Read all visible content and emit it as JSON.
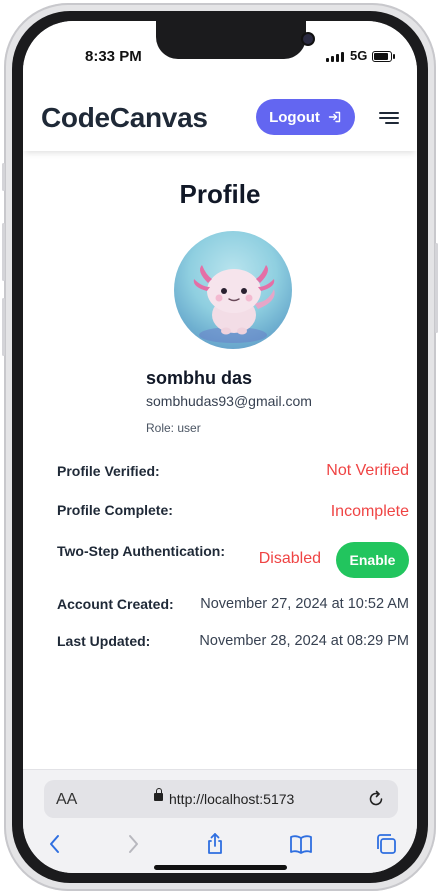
{
  "status_bar": {
    "time": "8:33 PM",
    "network": "5G"
  },
  "header": {
    "brand": "CodeCanvas",
    "logout_label": "Logout"
  },
  "profile": {
    "title": "Profile",
    "name": "sombhu das",
    "email": "sombhudas93@gmail.com",
    "role": "Role: user"
  },
  "details": [
    {
      "label": "Profile Verified:",
      "value": "Not Verified"
    },
    {
      "label": "Profile Complete:",
      "value": "Incomplete"
    },
    {
      "label": "Two-Step Authentication:",
      "value": "Disabled",
      "action": "Enable"
    },
    {
      "label": "Account Created:",
      "value": "November 27, 2024 at 10:52 AM"
    },
    {
      "label": "Last Updated:",
      "value": "November 28, 2024 at 08:29 PM"
    }
  ],
  "browser": {
    "text_size_label": "AA",
    "url": "http://localhost:5173"
  },
  "colors": {
    "accent": "#6366f1",
    "success": "#22c55e",
    "danger": "#ef4444"
  },
  "icons": [
    "logout-arrow-icon",
    "hamburger-menu-icon",
    "lock-icon",
    "reload-icon",
    "back-icon",
    "forward-icon",
    "share-icon",
    "bookmarks-icon",
    "tabs-icon"
  ]
}
